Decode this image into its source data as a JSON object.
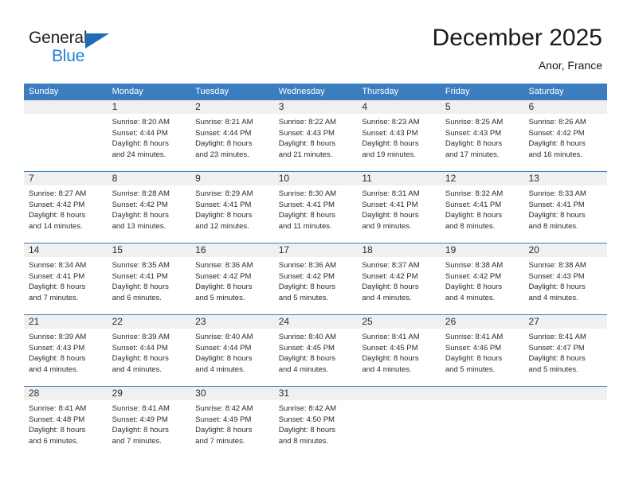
{
  "brand": {
    "name_part1": "General",
    "name_part2": "Blue",
    "color_dark": "#232323",
    "color_blue": "#1f7fd4",
    "triangle_color": "#1f6cb4"
  },
  "header": {
    "title": "December 2025",
    "location": "Anor, France"
  },
  "theme": {
    "header_blue": "#3b7dbf",
    "daynum_band": "#f0f0f0",
    "cell_bg": "#ffffff",
    "text": "#2b2b2b"
  },
  "weekdays": [
    "Sunday",
    "Monday",
    "Tuesday",
    "Wednesday",
    "Thursday",
    "Friday",
    "Saturday"
  ],
  "weeks": [
    [
      {
        "day": "",
        "lines": []
      },
      {
        "day": "1",
        "lines": [
          "Sunrise: 8:20 AM",
          "Sunset: 4:44 PM",
          "Daylight: 8 hours",
          "and 24 minutes."
        ]
      },
      {
        "day": "2",
        "lines": [
          "Sunrise: 8:21 AM",
          "Sunset: 4:44 PM",
          "Daylight: 8 hours",
          "and 23 minutes."
        ]
      },
      {
        "day": "3",
        "lines": [
          "Sunrise: 8:22 AM",
          "Sunset: 4:43 PM",
          "Daylight: 8 hours",
          "and 21 minutes."
        ]
      },
      {
        "day": "4",
        "lines": [
          "Sunrise: 8:23 AM",
          "Sunset: 4:43 PM",
          "Daylight: 8 hours",
          "and 19 minutes."
        ]
      },
      {
        "day": "5",
        "lines": [
          "Sunrise: 8:25 AM",
          "Sunset: 4:43 PM",
          "Daylight: 8 hours",
          "and 17 minutes."
        ]
      },
      {
        "day": "6",
        "lines": [
          "Sunrise: 8:26 AM",
          "Sunset: 4:42 PM",
          "Daylight: 8 hours",
          "and 16 minutes."
        ]
      }
    ],
    [
      {
        "day": "7",
        "lines": [
          "Sunrise: 8:27 AM",
          "Sunset: 4:42 PM",
          "Daylight: 8 hours",
          "and 14 minutes."
        ]
      },
      {
        "day": "8",
        "lines": [
          "Sunrise: 8:28 AM",
          "Sunset: 4:42 PM",
          "Daylight: 8 hours",
          "and 13 minutes."
        ]
      },
      {
        "day": "9",
        "lines": [
          "Sunrise: 8:29 AM",
          "Sunset: 4:41 PM",
          "Daylight: 8 hours",
          "and 12 minutes."
        ]
      },
      {
        "day": "10",
        "lines": [
          "Sunrise: 8:30 AM",
          "Sunset: 4:41 PM",
          "Daylight: 8 hours",
          "and 11 minutes."
        ]
      },
      {
        "day": "11",
        "lines": [
          "Sunrise: 8:31 AM",
          "Sunset: 4:41 PM",
          "Daylight: 8 hours",
          "and 9 minutes."
        ]
      },
      {
        "day": "12",
        "lines": [
          "Sunrise: 8:32 AM",
          "Sunset: 4:41 PM",
          "Daylight: 8 hours",
          "and 8 minutes."
        ]
      },
      {
        "day": "13",
        "lines": [
          "Sunrise: 8:33 AM",
          "Sunset: 4:41 PM",
          "Daylight: 8 hours",
          "and 8 minutes."
        ]
      }
    ],
    [
      {
        "day": "14",
        "lines": [
          "Sunrise: 8:34 AM",
          "Sunset: 4:41 PM",
          "Daylight: 8 hours",
          "and 7 minutes."
        ]
      },
      {
        "day": "15",
        "lines": [
          "Sunrise: 8:35 AM",
          "Sunset: 4:41 PM",
          "Daylight: 8 hours",
          "and 6 minutes."
        ]
      },
      {
        "day": "16",
        "lines": [
          "Sunrise: 8:36 AM",
          "Sunset: 4:42 PM",
          "Daylight: 8 hours",
          "and 5 minutes."
        ]
      },
      {
        "day": "17",
        "lines": [
          "Sunrise: 8:36 AM",
          "Sunset: 4:42 PM",
          "Daylight: 8 hours",
          "and 5 minutes."
        ]
      },
      {
        "day": "18",
        "lines": [
          "Sunrise: 8:37 AM",
          "Sunset: 4:42 PM",
          "Daylight: 8 hours",
          "and 4 minutes."
        ]
      },
      {
        "day": "19",
        "lines": [
          "Sunrise: 8:38 AM",
          "Sunset: 4:42 PM",
          "Daylight: 8 hours",
          "and 4 minutes."
        ]
      },
      {
        "day": "20",
        "lines": [
          "Sunrise: 8:38 AM",
          "Sunset: 4:43 PM",
          "Daylight: 8 hours",
          "and 4 minutes."
        ]
      }
    ],
    [
      {
        "day": "21",
        "lines": [
          "Sunrise: 8:39 AM",
          "Sunset: 4:43 PM",
          "Daylight: 8 hours",
          "and 4 minutes."
        ]
      },
      {
        "day": "22",
        "lines": [
          "Sunrise: 8:39 AM",
          "Sunset: 4:44 PM",
          "Daylight: 8 hours",
          "and 4 minutes."
        ]
      },
      {
        "day": "23",
        "lines": [
          "Sunrise: 8:40 AM",
          "Sunset: 4:44 PM",
          "Daylight: 8 hours",
          "and 4 minutes."
        ]
      },
      {
        "day": "24",
        "lines": [
          "Sunrise: 8:40 AM",
          "Sunset: 4:45 PM",
          "Daylight: 8 hours",
          "and 4 minutes."
        ]
      },
      {
        "day": "25",
        "lines": [
          "Sunrise: 8:41 AM",
          "Sunset: 4:45 PM",
          "Daylight: 8 hours",
          "and 4 minutes."
        ]
      },
      {
        "day": "26",
        "lines": [
          "Sunrise: 8:41 AM",
          "Sunset: 4:46 PM",
          "Daylight: 8 hours",
          "and 5 minutes."
        ]
      },
      {
        "day": "27",
        "lines": [
          "Sunrise: 8:41 AM",
          "Sunset: 4:47 PM",
          "Daylight: 8 hours",
          "and 5 minutes."
        ]
      }
    ],
    [
      {
        "day": "28",
        "lines": [
          "Sunrise: 8:41 AM",
          "Sunset: 4:48 PM",
          "Daylight: 8 hours",
          "and 6 minutes."
        ]
      },
      {
        "day": "29",
        "lines": [
          "Sunrise: 8:41 AM",
          "Sunset: 4:49 PM",
          "Daylight: 8 hours",
          "and 7 minutes."
        ]
      },
      {
        "day": "30",
        "lines": [
          "Sunrise: 8:42 AM",
          "Sunset: 4:49 PM",
          "Daylight: 8 hours",
          "and 7 minutes."
        ]
      },
      {
        "day": "31",
        "lines": [
          "Sunrise: 8:42 AM",
          "Sunset: 4:50 PM",
          "Daylight: 8 hours",
          "and 8 minutes."
        ]
      },
      {
        "day": "",
        "lines": []
      },
      {
        "day": "",
        "lines": []
      },
      {
        "day": "",
        "lines": []
      }
    ]
  ]
}
